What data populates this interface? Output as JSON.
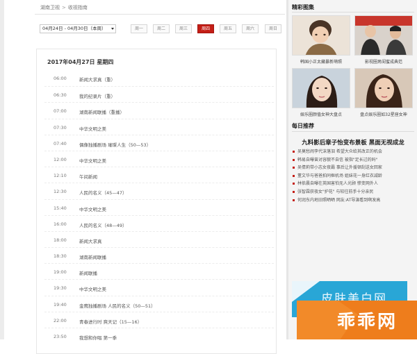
{
  "breadcrumb": {
    "channel": "湖南卫视",
    "page": "收视指南"
  },
  "week_selector": {
    "value": "04月24日 - 04月30日（本周）"
  },
  "days": [
    {
      "label": "周一",
      "active": false
    },
    {
      "label": "周二",
      "active": false
    },
    {
      "label": "周三",
      "active": false
    },
    {
      "label": "周四",
      "active": true
    },
    {
      "label": "周五",
      "active": false
    },
    {
      "label": "周六",
      "active": false
    },
    {
      "label": "周日",
      "active": false
    }
  ],
  "schedule": {
    "date_title": "2017年04月27日 星期四",
    "programs": [
      {
        "time": "06:00",
        "title": "新闻大求真（重）"
      },
      {
        "time": "06:30",
        "title": "我的纪录片（重）"
      },
      {
        "time": "07:00",
        "title": "湖南新闻联播（重播）"
      },
      {
        "time": "07:30",
        "title": "中华文明之美"
      },
      {
        "time": "07:40",
        "title": "偶像独播剧场 璀璨人生（50—53）"
      },
      {
        "time": "12:00",
        "title": "中华文明之美"
      },
      {
        "time": "12:10",
        "title": "午间新闻"
      },
      {
        "time": "12:30",
        "title": "人民的名义（45—47）"
      },
      {
        "time": "15:40",
        "title": "中华文明之美"
      },
      {
        "time": "16:00",
        "title": "人民的名义（48—49）"
      },
      {
        "time": "18:00",
        "title": "新闻大求真"
      },
      {
        "time": "18:30",
        "title": "湖南新闻联播"
      },
      {
        "time": "19:00",
        "title": "新闻联播"
      },
      {
        "time": "19:30",
        "title": "中华文明之美"
      },
      {
        "time": "19:40",
        "title": "金鹰独播剧场 人民的名义（50—51）"
      },
      {
        "time": "22:00",
        "title": "青春进行时 爽天记（15—16）"
      },
      {
        "time": "23:50",
        "title": "我想和你唱 第一季"
      }
    ]
  },
  "sidebar": {
    "gallery_title": "精彩图集",
    "photos": [
      {
        "caption": "韩国小正太藏暴新萌照"
      },
      {
        "caption": "影视圈男闺蜜成典范"
      },
      {
        "caption": "娱乐圈颜值女神大盘点"
      },
      {
        "caption": "盘点娱乐圈如32星座女神"
      }
    ],
    "recommend_title": "每日推荐",
    "headline": "九料影后章子怡变布景板 黑面无视成龙",
    "news": [
      "吴莫愁闹李代沫落泪 希望大众给其改正的机会",
      "韩易自曝曾对容貌不自信 被指\"足长过的码\"",
      "吴倩莉带小志女夜霸 事后让外援顿刮送女回家",
      "董文华与爸爸拍同框机场 姐妹花一身红衣减龄",
      "林依晨自曝在英国害怕无人光顾 惨变网外人",
      "张智霖获夜女\"护花\" 与较往前手十分亲民",
      "何润东内地旧照晒晒 网友:AT导演看到啊发高"
    ],
    "banner_text": "皮肤美白网"
  },
  "watermark_text": "乖乖网",
  "colors": {
    "accent": "#c41e16",
    "banner": "#29a6d6",
    "watermark": "#ee7d1c"
  }
}
